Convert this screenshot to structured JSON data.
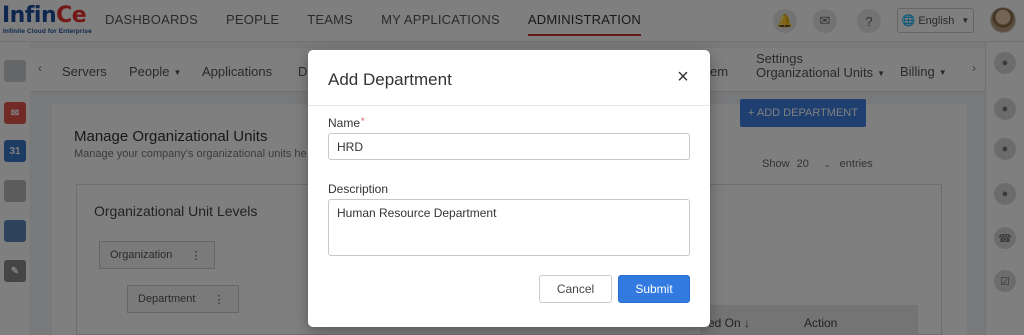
{
  "brand": {
    "name_main": "Infin",
    "name_accent": "Ce",
    "tagline": "Infinite Cloud for Enterprise"
  },
  "main_nav": [
    "DASHBOARDS",
    "PEOPLE",
    "TEAMS",
    "MY APPLICATIONS",
    "ADMINISTRATION"
  ],
  "main_nav_active": "ADMINISTRATION",
  "topbar": {
    "language": "English",
    "icons": [
      "bell-icon",
      "inbox-icon",
      "help-icon",
      "globe-icon"
    ]
  },
  "sub_nav": {
    "items": [
      "Servers",
      "People",
      "Applications",
      "D",
      "em",
      "Billing"
    ],
    "settings_label": "Settings",
    "settings_value": "Organizational Units"
  },
  "page": {
    "title": "Manage Organizational Units",
    "subtitle": "Manage your company's organizational units he"
  },
  "panel": {
    "title": "Organizational Unit Levels",
    "levels": [
      "Organization",
      "Department"
    ],
    "add_button": "+ ADD DEPARTMENT",
    "show_label": "Show",
    "show_value": "20",
    "entries_label": "entries",
    "table_headers": [
      "ed On ↓",
      "Action"
    ]
  },
  "modal": {
    "title": "Add Department",
    "name_label": "Name",
    "required_mark": "*",
    "name_value": "HRD",
    "description_label": "Description",
    "description_value": "Human Resource Department",
    "cancel_label": "Cancel",
    "submit_label": "Submit"
  },
  "colors": {
    "accent": "#3279e0",
    "brand": "#1f4f9c",
    "brand_accent": "#e8322f",
    "active_underline": "#c9302c"
  }
}
